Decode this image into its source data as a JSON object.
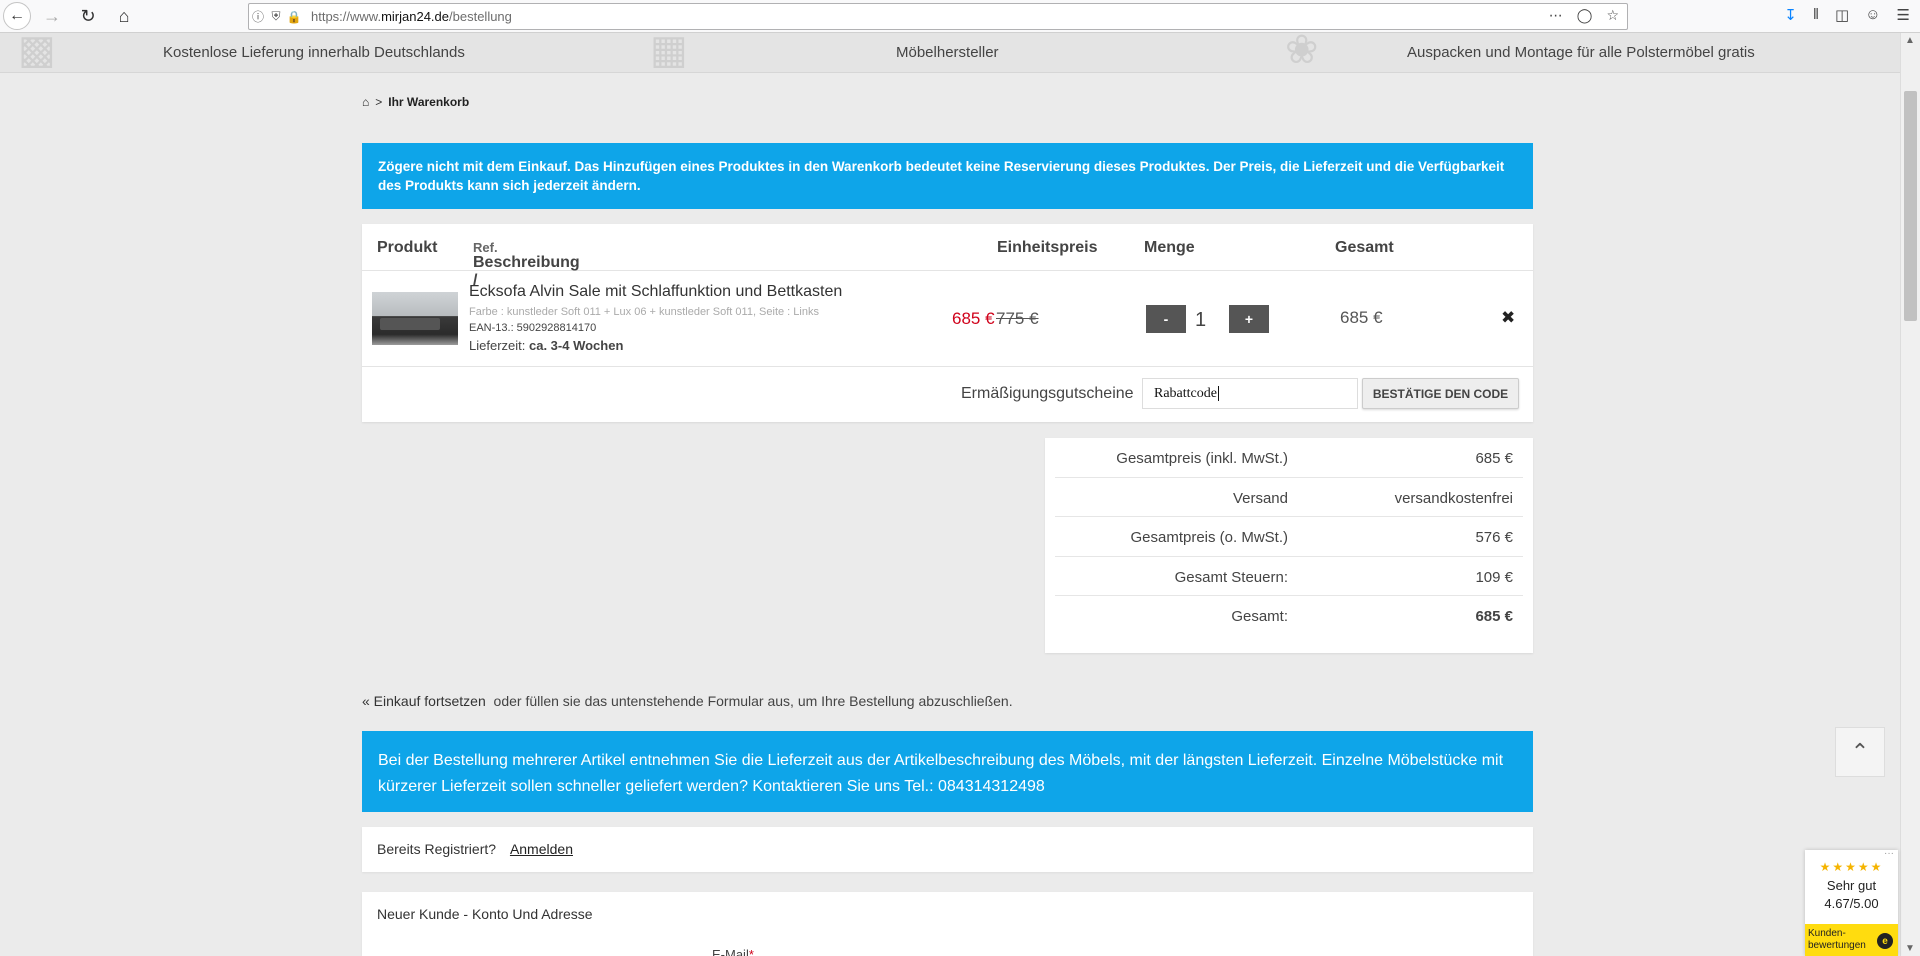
{
  "browser": {
    "url_prefix": "https://www.",
    "url_domain": "mirjan24.de",
    "url_path": "/bestellung"
  },
  "info_strip": {
    "delivery": "Kostenlose Lieferung innerhalb Deutschlands",
    "manufacturer": "Möbelhersteller",
    "assembly": "Auspacken und Montage für alle Polstermöbel gratis"
  },
  "breadcrumb": {
    "separator": ">",
    "current": "Ihr Warenkorb"
  },
  "notice": "Zögere nicht mit dem Einkauf. Das Hinzufügen eines Produktes in den Warenkorb bedeutet keine Reservierung dieses Produktes. Der Preis, die Lieferzeit und die Verfügbarkeit des Produkts kann sich jederzeit ändern.",
  "cart": {
    "headers": {
      "product": "Produkt",
      "description": "Beschreibung /",
      "ref": "Ref.",
      "unit_price": "Einheitspreis",
      "quantity": "Menge",
      "total": "Gesamt"
    },
    "item": {
      "title": "Ecksofa Alvin Sale mit Schlaffunktion und Bettkasten",
      "attributes": "Farbe : kunstleder Soft 011 + Lux 06 + kunstleder Soft 011, Seite : Links",
      "ean": "EAN-13.: 5902928814170",
      "delivery_label": "Lieferzeit:",
      "delivery_value": "ca. 3-4 Wochen",
      "price_now": "685 €",
      "price_old": "775 €",
      "minus": "-",
      "quantity": "1",
      "plus": "+",
      "line_total": "685 €",
      "remove": "✖"
    },
    "voucher": {
      "label": "Ermäßigungsgutscheine",
      "value": "Rabattcode",
      "button": "BESTÄTIGE DEN CODE"
    }
  },
  "summary": [
    {
      "label": "Gesamtpreis (inkl. MwSt.)",
      "value": "685 €"
    },
    {
      "label": "Versand",
      "value": "versandkostenfrei"
    },
    {
      "label": "Gesamtpreis (o. MwSt.)",
      "value": "576 €"
    },
    {
      "label": "Gesamt Steuern:",
      "value": "109 €"
    },
    {
      "label": "Gesamt:",
      "value": "685 €"
    }
  ],
  "continue": {
    "link": "« Einkauf fortsetzen",
    "text": "oder füllen sie das untenstehende Formular aus, um Ihre Bestellung abzuschließen."
  },
  "delivery_notice": "Bei der Bestellung mehrerer Artikel entnehmen Sie die Lieferzeit aus der Artikelbeschreibung des Möbels, mit der längsten Lieferzeit. Einzelne Möbelstücke mit kürzerer Lieferzeit sollen schneller geliefert werden? Kontaktieren Sie uns Tel.: 084314312498",
  "login": {
    "question": "Bereits Registriert?",
    "link": "Anmelden"
  },
  "new_customer": {
    "title": "Neuer Kunde - Konto Und Adresse",
    "email_label": "E-Mail",
    "required_mark": "*"
  },
  "rating": {
    "stars": "★★★★★",
    "grade": "Sehr gut",
    "score": "4.67/5.00",
    "footer": "Kunden-bewertungen",
    "badge": "e",
    "menu": "···"
  },
  "colors": {
    "accent": "#0ea5e9",
    "price_sale": "#d0021b",
    "rating_yellow": "#ffdc0f"
  }
}
